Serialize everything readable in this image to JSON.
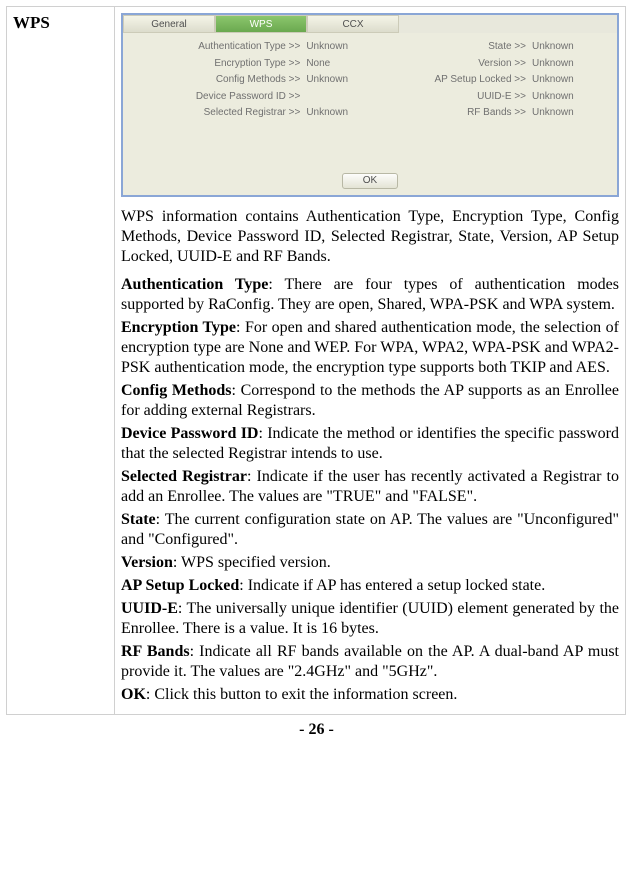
{
  "header": "WPS",
  "tabs": [
    "General",
    "WPS",
    "CCX"
  ],
  "active_tab": 1,
  "left_fields": [
    {
      "label": "Authentication Type >> ",
      "value": "Unknown"
    },
    {
      "label": "Encryption Type >> ",
      "value": "None"
    },
    {
      "label": "Config Methods >> ",
      "value": "Unknown"
    },
    {
      "label": "Device Password ID >> ",
      "value": ""
    },
    {
      "label": "Selected Registrar >> ",
      "value": "Unknown"
    }
  ],
  "right_fields": [
    {
      "label": "State >> ",
      "value": "Unknown"
    },
    {
      "label": "Version >> ",
      "value": "Unknown"
    },
    {
      "label": "AP Setup Locked >> ",
      "value": "Unknown"
    },
    {
      "label": "UUID-E >> ",
      "value": "Unknown"
    },
    {
      "label": "RF Bands >> ",
      "value": "Unknown"
    }
  ],
  "ok_label": "OK",
  "intro": "WPS information contains Authentication Type, Encryption Type, Config Methods, Device Password ID, Selected Registrar, State, Version, AP Setup Locked, UUID-E and RF Bands.",
  "defs": [
    {
      "term": "Authentication Type",
      "text": ": There are four types of authentication modes supported by RaConfig. They are open, Shared, WPA-PSK and WPA system."
    },
    {
      "term": "Encryption Type",
      "text": ": For open and shared authentication mode, the selection of encryption type are None and WEP. For WPA, WPA2, WPA-PSK and WPA2-PSK authentication mode, the encryption type supports both TKIP and AES."
    },
    {
      "term": "Config Methods",
      "text": ": Correspond to the methods the AP supports as an Enrollee for adding external Registrars."
    },
    {
      "term": "Device Password ID",
      "text": ": Indicate the method or identifies the specific password that the selected Registrar intends to use."
    },
    {
      "term": "Selected Registrar",
      "text": ": Indicate if the user has recently activated a Registrar to add an Enrollee. The values are \"TRUE\" and \"FALSE\"."
    },
    {
      "term": "State",
      "text": ": The current configuration state on AP. The values are \"Unconfigured\" and \"Configured\"."
    },
    {
      "term": "Version",
      "text": ": WPS specified version."
    },
    {
      "term": "AP Setup Locked",
      "text": ": Indicate if AP has entered a setup locked state."
    },
    {
      "term": "UUID-E",
      "text": ": The universally unique identifier (UUID) element generated by the Enrollee. There is a value. It is 16 bytes."
    },
    {
      "term": "RF Bands",
      "text": ": Indicate all RF bands available on the AP. A dual-band AP must provide it. The values are \"2.4GHz\" and \"5GHz\"."
    },
    {
      "term": "OK",
      "text": ": Click this button to exit the information screen."
    }
  ],
  "page_number": "- 26 -"
}
